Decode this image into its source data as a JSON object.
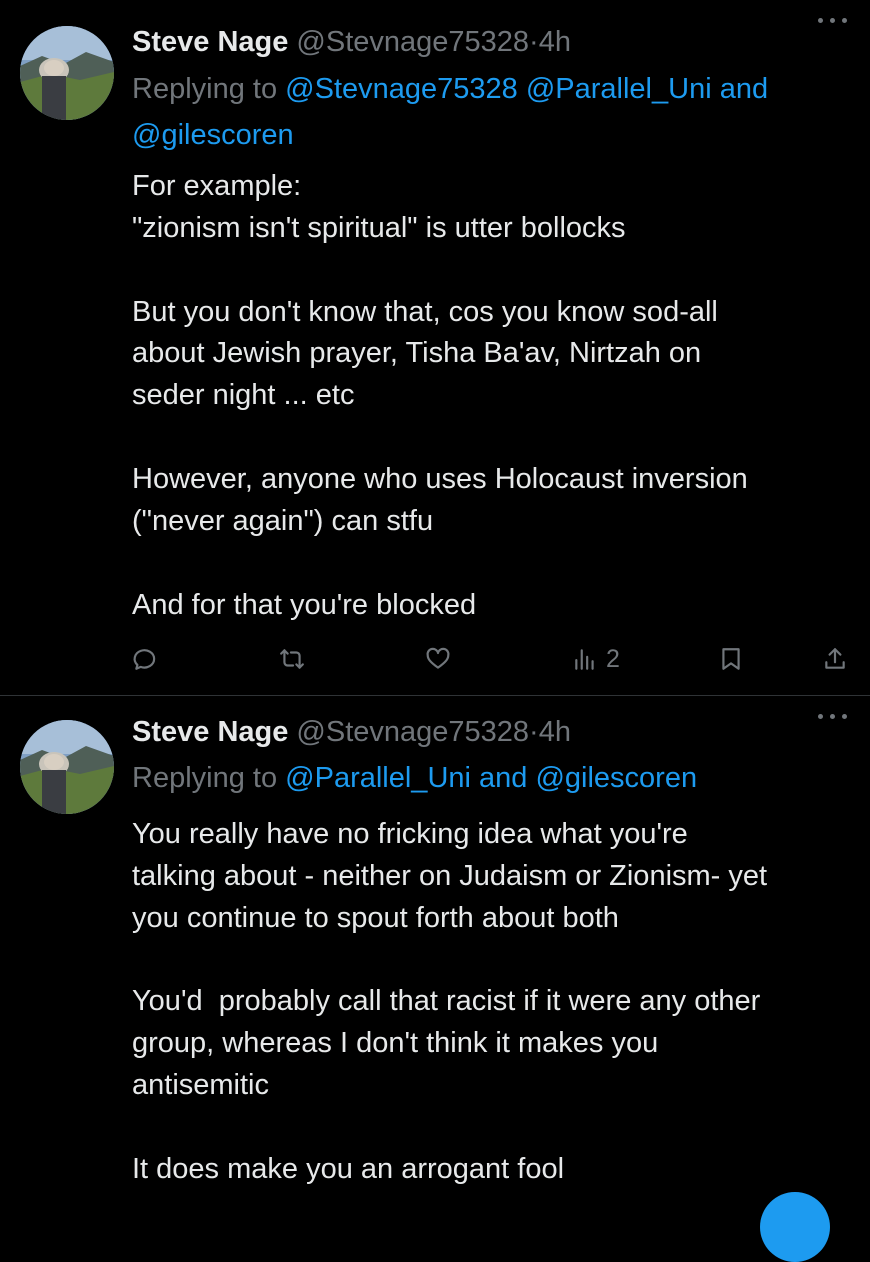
{
  "tweets": [
    {
      "author_name": "Steve Nage",
      "author_handle": "@Stevnage75328",
      "separator": "·",
      "time": "4h",
      "replying_prefix": "Replying to",
      "replying_mentions": [
        "@Stevnage75328",
        "@Parallel_Uni"
      ],
      "replying_and": "and",
      "replying_last": "@gilescoren",
      "paragraphs": [
        [
          "For example:",
          "\"zionism isn't spiritual\" is utter bollocks"
        ],
        [
          "But you don't know that, cos you know sod-all",
          "about Jewish prayer, Tisha Ba'av, Nirtzah on",
          "seder night ... etc"
        ],
        [
          "However, anyone who uses Holocaust inversion",
          "(\"never again\") can stfu"
        ],
        [
          "And for that you're blocked"
        ]
      ],
      "views_count": "2",
      "icons": [
        "reply-icon",
        "retweet-icon",
        "like-icon",
        "views-icon",
        "bookmark-icon",
        "share-icon"
      ]
    },
    {
      "author_name": "Steve Nage",
      "author_handle": "@Stevnage75328",
      "separator": "·",
      "time": "4h",
      "replying_prefix": "Replying to",
      "replying_mentions": [
        "@Parallel_Uni"
      ],
      "replying_and": "and",
      "replying_last": "@gilescoren",
      "paragraphs": [
        [
          "You really have no fricking idea what you're",
          "talking about - neither on Judaism or Zionism- yet",
          "you continue to spout forth about both"
        ],
        [
          "You'd  probably call that racist if it were any other",
          "group, whereas I don't think it makes you",
          "antisemitic"
        ],
        [
          "It does make you an arrogant fool"
        ]
      ]
    }
  ],
  "colors": {
    "background": "#000000",
    "text": "#e7e9ea",
    "muted": "#71767b",
    "link": "#1d9bf0",
    "divider": "#2f3336"
  }
}
